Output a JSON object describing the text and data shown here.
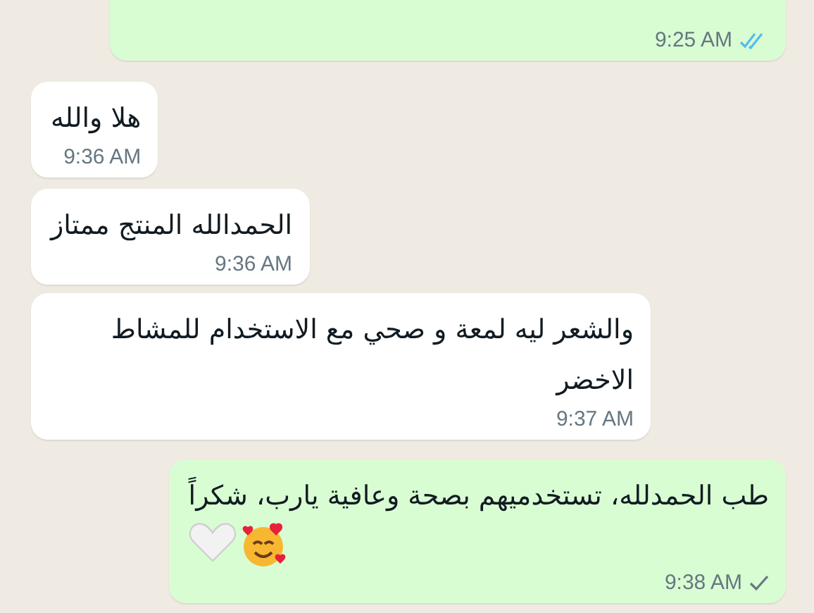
{
  "messages": [
    {
      "kind": "outgoing",
      "time": "9:25 AM",
      "read": true
    },
    {
      "kind": "incoming",
      "text": "هلا والله",
      "time": "9:36 AM"
    },
    {
      "kind": "incoming",
      "text": "الحمدالله المنتج ممتاز",
      "time": "9:36 AM"
    },
    {
      "kind": "incoming",
      "text": "والشعر ليه لمعة و صحي مع الاستخدام للمشاط الاخضر",
      "time": "9:37 AM"
    },
    {
      "kind": "outgoing",
      "text": "طب الحمدلله، تستخدميهم بصحة وعافية يارب، شكراً",
      "time": "9:38 AM",
      "read": false,
      "attachments": [
        {
          "kind": "smiling-face"
        },
        {
          "kind": "heart"
        }
      ]
    }
  ]
}
